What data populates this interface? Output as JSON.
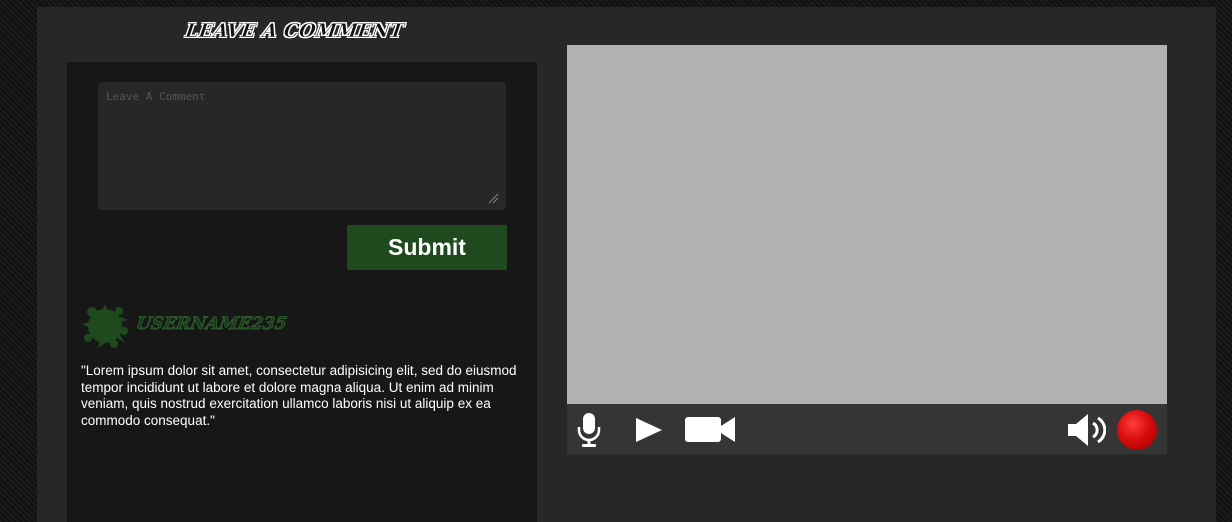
{
  "comment_section": {
    "title": "Leave A Comment",
    "textarea_placeholder": "Leave A Comment",
    "textarea_value": "",
    "submit_label": "Submit"
  },
  "comments": [
    {
      "username": "USERNAME235",
      "text": "\"Lorem ipsum dolor sit amet, consectetur adipisicing elit, sed do eiusmod tempor incididunt ut labore et dolore magna aliqua. Ut enim ad minim veniam, quis nostrud exercitation ullamco laboris nisi ut aliquip ex ea commodo consequat.\""
    }
  ],
  "video_player": {
    "controls": [
      "microphone-icon",
      "play-icon",
      "camera-icon",
      "volume-icon",
      "record-button"
    ],
    "colors": {
      "screen": "#b1b1b1",
      "control_bar": "#353535",
      "record": "#e01414"
    }
  },
  "colors": {
    "submit_bg": "#1e4a1d",
    "username": "#2f6a2d",
    "panel": "#181718"
  }
}
